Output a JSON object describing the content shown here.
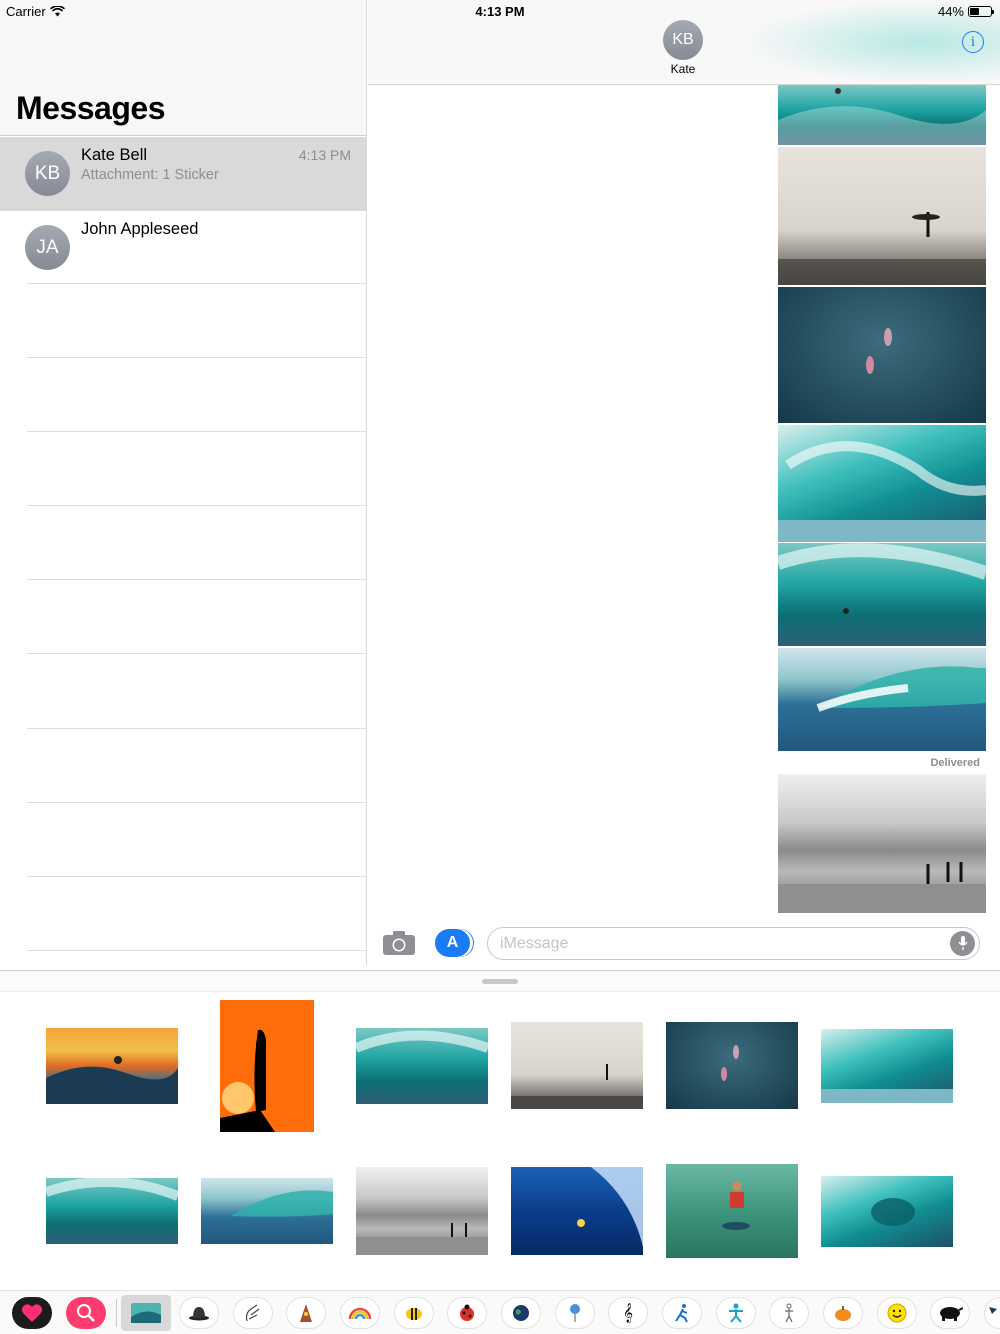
{
  "status_bar": {
    "carrier": "Carrier",
    "time": "4:13 PM",
    "battery": "44%",
    "battery_level": 0.44
  },
  "sidebar": {
    "title": "Messages",
    "conversations": [
      {
        "initials": "KB",
        "name": "Kate Bell",
        "preview": "Attachment: 1 Sticker",
        "time": "4:13 PM",
        "selected": true
      },
      {
        "initials": "JA",
        "name": "John Appleseed",
        "preview": "",
        "time": "",
        "selected": false
      }
    ]
  },
  "chat": {
    "contact_initials": "KB",
    "contact_name": "Kate",
    "delivered_label": "Delivered",
    "info_icon": "info-icon"
  },
  "input_bar": {
    "placeholder": "iMessage",
    "value": "",
    "camera_icon": "camera-icon",
    "appstore_icon": "app-store-icon",
    "mic_icon": "microphone-icon"
  },
  "app_strip": {
    "icons": [
      "recent-stickers-icon",
      "search-images-icon",
      "surf-stickers-icon",
      "bowler-hat-icon",
      "hand-drawing-icon",
      "monster-icon",
      "rainbow-icon",
      "bee-icon",
      "ladybug-icon",
      "earth-icon",
      "balloon-icon",
      "treble-clef-icon",
      "runner-icon",
      "dancer-icon",
      "stick-figure-icon",
      "pumpkin-icon",
      "smiley-icon",
      "pig-icon",
      "flag-icon"
    ]
  }
}
